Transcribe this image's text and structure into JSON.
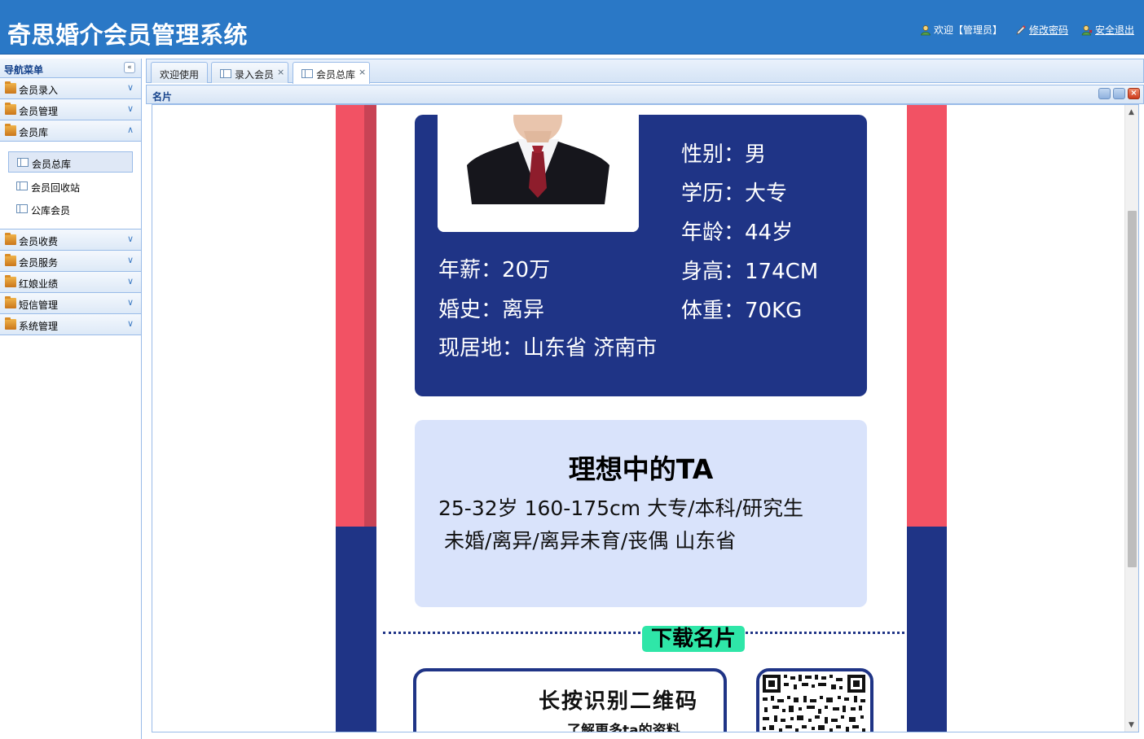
{
  "header": {
    "title": "奇思婚介会员管理系统",
    "welcome": "欢迎【管理员】",
    "change_password": "修改密码",
    "logout": "安全退出"
  },
  "sidebar": {
    "title": "导航菜单",
    "collapse_glyph": "«",
    "menus": [
      {
        "label": "会员录入",
        "expanded": false
      },
      {
        "label": "会员管理",
        "expanded": false
      },
      {
        "label": "会员库",
        "expanded": true
      },
      {
        "label": "会员收费",
        "expanded": false
      },
      {
        "label": "会员服务",
        "expanded": false
      },
      {
        "label": "红娘业绩",
        "expanded": false
      },
      {
        "label": "短信管理",
        "expanded": false
      },
      {
        "label": "系统管理",
        "expanded": false
      }
    ],
    "submenu": [
      {
        "label": "会员总库",
        "selected": true
      },
      {
        "label": "会员回收站",
        "selected": false
      },
      {
        "label": "公库会员",
        "selected": false
      }
    ]
  },
  "tabs": [
    {
      "label": "欢迎使用",
      "closable": false,
      "active": false
    },
    {
      "label": "录入会员",
      "closable": true,
      "active": false
    },
    {
      "label": "会员总库",
      "closable": true,
      "active": true
    }
  ],
  "panel": {
    "title": "名片"
  },
  "card": {
    "gender": "性别：男",
    "education": "学历：大专",
    "age": "年龄：44岁",
    "salary": "年薪：20万",
    "height": "身高：174CM",
    "marriage": "婚史：离异",
    "weight": "体重：70KG",
    "residence": "现居地：山东省 济南市",
    "ideal_title": "理想中的TA",
    "ideal_line1": "25-32岁  160-175cm  大专/本科/研究生",
    "ideal_line2": "未婚/离异/离异未育/丧偶  山东省",
    "download_label": "下载名片",
    "qr_title": "长按识别二维码",
    "qr_subtitle": "了解更多ta的资料"
  },
  "colors": {
    "header_blue": "#2a78c6",
    "card_navy": "#1f3486",
    "stripe_red": "#f25264",
    "stripe_dark_red": "#c84355",
    "light_card": "#d9e3fb",
    "badge_green": "#2fe6a8"
  }
}
